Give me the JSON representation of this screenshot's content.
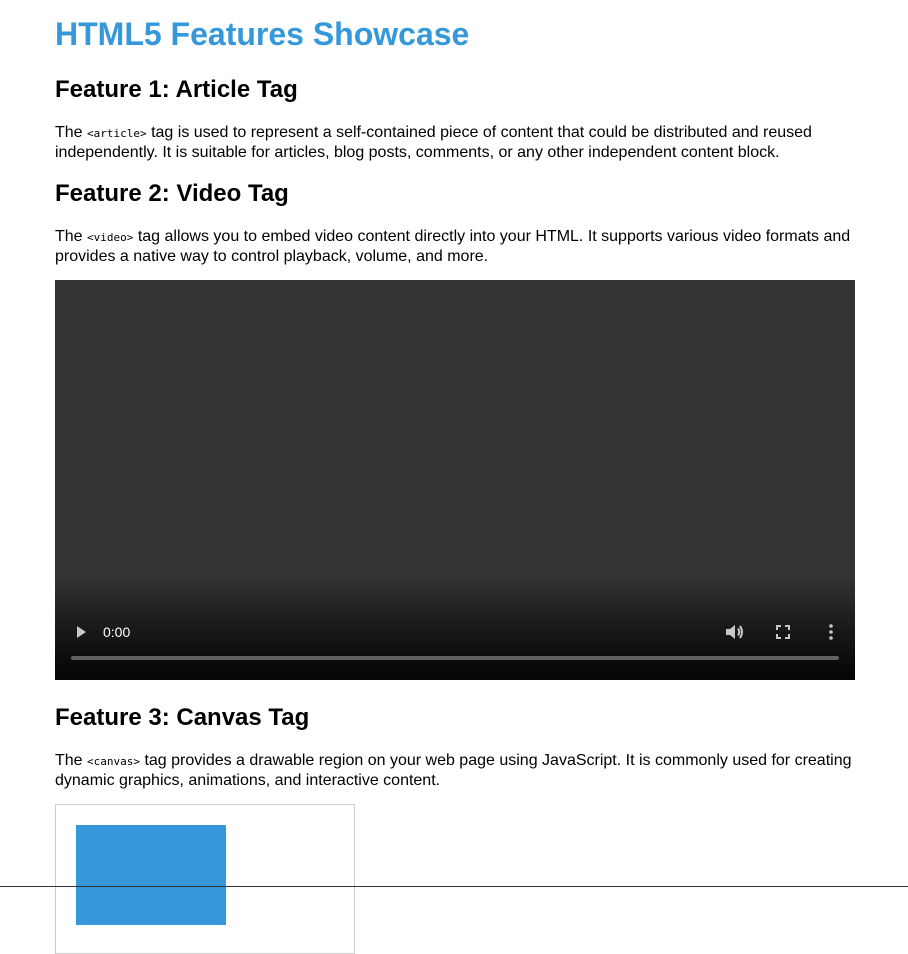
{
  "page": {
    "title": "HTML5 Features Showcase"
  },
  "colors": {
    "accent": "#3498db",
    "video_background": "#333333",
    "canvas_fill": "#3498db",
    "canvas_border": "#cccccc"
  },
  "features": [
    {
      "heading": "Feature 1: Article Tag",
      "text_before": "The ",
      "code": "<article>",
      "text_after": " tag is used to represent a self-contained piece of content that could be distributed and reused independently. It is suitable for articles, blog posts, comments, or any other independent content block."
    },
    {
      "heading": "Feature 2: Video Tag",
      "text_before": "The ",
      "code": "<video>",
      "text_after": " tag allows you to embed video content directly into your HTML. It supports various video formats and provides a native way to control playback, volume, and more."
    },
    {
      "heading": "Feature 3: Canvas Tag",
      "text_before": "The ",
      "code": "<canvas>",
      "text_after": " tag provides a drawable region on your web page using JavaScript. It is commonly used for creating dynamic graphics, animations, and interactive content."
    }
  ],
  "video": {
    "current_time": "0:00",
    "progress": 0,
    "icons": {
      "play": "play-icon",
      "volume": "volume-icon",
      "fullscreen": "fullscreen-icon",
      "more": "more-options-icon"
    }
  }
}
